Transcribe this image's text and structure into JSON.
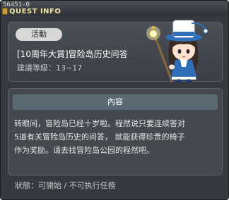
{
  "window": {
    "quest_id": "56451-0",
    "title": "QUEST INFO"
  },
  "quest": {
    "category_badge": "活動",
    "name": "[10周年大賞]冒险岛历史问答",
    "level": "建議等級：13~17"
  },
  "content": {
    "header": "內容",
    "lines": [
      "转眼间，冒险岛已经十岁啦。程然说只要连续答对",
      "5道有关冒险岛历史的问答， 就能获得珍贵的椅子",
      "作为奖励。请去找冒险岛公园的程然吧。"
    ]
  },
  "status": "狀態：可開始 / 不可执行任務",
  "colors": {
    "window_bg": "#36393f",
    "title_text": "#f4e3a4",
    "header_bar": "#5a6a73",
    "badge_bg": "#d7d7d7"
  },
  "icons": {
    "title": "quest-book-icon",
    "npc": "npc-character-illustration"
  }
}
